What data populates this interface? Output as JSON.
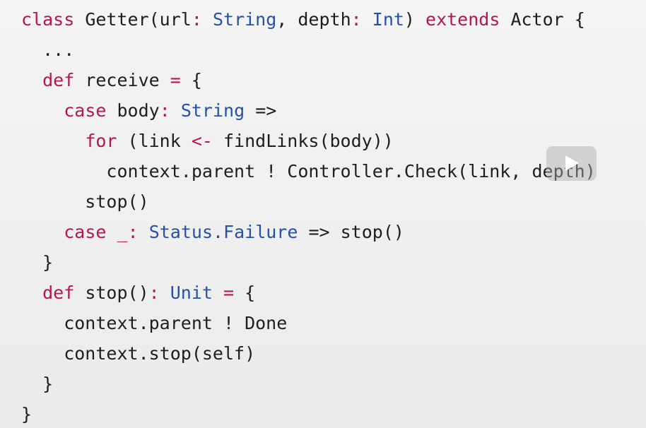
{
  "colors": {
    "background": "#efefef",
    "keyword": "#b5174b",
    "type": "#2451a8",
    "plain": "#1e1e1e"
  },
  "code": {
    "lines": [
      [
        {
          "t": "kw",
          "v": "class"
        },
        {
          "t": "pl",
          "v": " Getter(url"
        },
        {
          "t": "kw",
          "v": ":"
        },
        {
          "t": "pl",
          "v": " "
        },
        {
          "t": "ty",
          "v": "String"
        },
        {
          "t": "pl",
          "v": ", depth"
        },
        {
          "t": "kw",
          "v": ":"
        },
        {
          "t": "pl",
          "v": " "
        },
        {
          "t": "ty",
          "v": "Int"
        },
        {
          "t": "pl",
          "v": ") "
        },
        {
          "t": "kw",
          "v": "extends"
        },
        {
          "t": "pl",
          "v": " Actor {"
        }
      ],
      [
        {
          "t": "pl",
          "v": "  ..."
        }
      ],
      [
        {
          "t": "pl",
          "v": "  "
        },
        {
          "t": "kw",
          "v": "def"
        },
        {
          "t": "pl",
          "v": " receive "
        },
        {
          "t": "kw",
          "v": "="
        },
        {
          "t": "pl",
          "v": " {"
        }
      ],
      [
        {
          "t": "pl",
          "v": "    "
        },
        {
          "t": "kw",
          "v": "case"
        },
        {
          "t": "pl",
          "v": " body"
        },
        {
          "t": "kw",
          "v": ":"
        },
        {
          "t": "pl",
          "v": " "
        },
        {
          "t": "ty",
          "v": "String"
        },
        {
          "t": "pl",
          "v": " =>"
        }
      ],
      [
        {
          "t": "pl",
          "v": "      "
        },
        {
          "t": "kw",
          "v": "for"
        },
        {
          "t": "pl",
          "v": " (link "
        },
        {
          "t": "kw",
          "v": "<-"
        },
        {
          "t": "pl",
          "v": " findLinks(body))"
        }
      ],
      [
        {
          "t": "pl",
          "v": "        context.parent ! Controller.Check(link, depth)"
        }
      ],
      [
        {
          "t": "pl",
          "v": "      stop()"
        }
      ],
      [
        {
          "t": "pl",
          "v": "    "
        },
        {
          "t": "kw",
          "v": "case"
        },
        {
          "t": "pl",
          "v": " "
        },
        {
          "t": "kw",
          "v": "_"
        },
        {
          "t": "kw",
          "v": ":"
        },
        {
          "t": "pl",
          "v": " "
        },
        {
          "t": "ty",
          "v": "Status.Failure"
        },
        {
          "t": "pl",
          "v": " => stop()"
        }
      ],
      [
        {
          "t": "pl",
          "v": "  }"
        }
      ],
      [
        {
          "t": "pl",
          "v": "  "
        },
        {
          "t": "kw",
          "v": "def"
        },
        {
          "t": "pl",
          "v": " stop()"
        },
        {
          "t": "kw",
          "v": ":"
        },
        {
          "t": "pl",
          "v": " "
        },
        {
          "t": "ty",
          "v": "Unit"
        },
        {
          "t": "pl",
          "v": " "
        },
        {
          "t": "kw",
          "v": "="
        },
        {
          "t": "pl",
          "v": " {"
        }
      ],
      [
        {
          "t": "pl",
          "v": "    context.parent ! Done"
        }
      ],
      [
        {
          "t": "pl",
          "v": "    context.stop(self)"
        }
      ],
      [
        {
          "t": "pl",
          "v": "  }"
        }
      ],
      [
        {
          "t": "pl",
          "v": "}"
        }
      ]
    ]
  },
  "overlay": {
    "icon": "play-icon"
  }
}
